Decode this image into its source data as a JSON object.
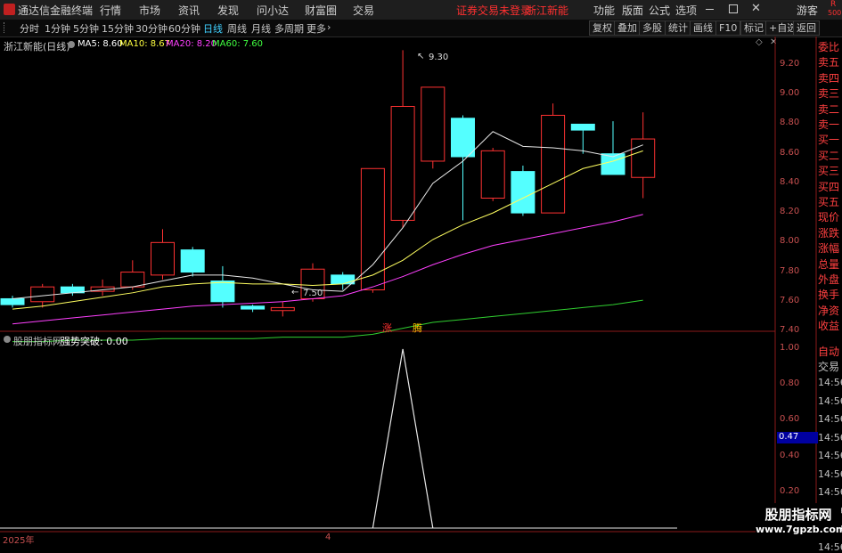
{
  "app": {
    "title": "通达信金融终端",
    "menus": [
      "行情",
      "市场",
      "资讯",
      "发现",
      "问小达",
      "财富圈",
      "交易"
    ],
    "status_left": "证券交易未登录",
    "status_right": "浙江新能",
    "right_menus": [
      "功能",
      "版面",
      "公式",
      "选项"
    ],
    "guest": "游客",
    "corner": "R",
    "corner_num": "500"
  },
  "toolbar": {
    "periods": [
      "分时",
      "1分钟",
      "5分钟",
      "15分钟",
      "30分钟",
      "60分钟",
      "日线",
      "周线",
      "月线",
      "多周期",
      "更多"
    ],
    "active_period": "日线",
    "buttons": [
      "复权",
      "叠加",
      "多股",
      "统计",
      "画线",
      "F10",
      "标记",
      "+自选",
      "返回"
    ]
  },
  "chart_header": {
    "stock": "浙江新能(日线)",
    "ma": [
      {
        "label": "MA5: 8.60",
        "color": "#ffffff"
      },
      {
        "label": "MA10: 8.67",
        "color": "#ffff40"
      },
      {
        "label": "MA20: 8.20",
        "color": "#ff40ff"
      },
      {
        "label": "MA60: 7.60",
        "color": "#40ff40"
      }
    ]
  },
  "indicator_header": {
    "name": "股朋指标网",
    "formula": "强势突破: 0.00"
  },
  "price_axis": [
    "9.20",
    "9.00",
    "8.80",
    "8.60",
    "8.40",
    "8.20",
    "8.00",
    "7.80",
    "7.60",
    "7.40"
  ],
  "ind_axis": [
    "1.00",
    "0.80",
    "0.60",
    "0.40",
    "0.20"
  ],
  "ind_current": "0.47",
  "annotations": {
    "high": "9.30",
    "low": "7.50",
    "rise": "涨",
    "surge": "腾"
  },
  "time_axis": {
    "year": "2025年",
    "month": "4"
  },
  "side_panel": {
    "quote_labels": [
      "委比",
      "卖五",
      "卖四",
      "卖三",
      "卖二",
      "卖一",
      "买一",
      "买二",
      "买三",
      "买四",
      "买五",
      "现价",
      "涨跌",
      "涨幅",
      "总量",
      "外盘",
      "换手",
      "净资",
      "收益"
    ],
    "trade_labels": [
      "自动",
      "交易"
    ],
    "times": [
      "14:56",
      "14:56",
      "14:56",
      "14:56",
      "14:56",
      "14:56",
      "14:56",
      "14:56",
      "14:56",
      "14:56"
    ]
  },
  "watermark": {
    "name": "股朋指标网",
    "url": "www.7gpzb.com"
  },
  "chart_data": {
    "type": "candlestick",
    "ylim": [
      7.3,
      9.35
    ],
    "candles": [
      {
        "o": 7.62,
        "c": 7.58,
        "h": 7.64,
        "l": 7.56
      },
      {
        "o": 7.6,
        "c": 7.7,
        "h": 7.72,
        "l": 7.56
      },
      {
        "o": 7.7,
        "c": 7.66,
        "h": 7.72,
        "l": 7.64
      },
      {
        "o": 7.67,
        "c": 7.7,
        "h": 7.75,
        "l": 7.64
      },
      {
        "o": 7.7,
        "c": 7.8,
        "h": 7.88,
        "l": 7.68
      },
      {
        "o": 7.78,
        "c": 8.0,
        "h": 8.09,
        "l": 7.75
      },
      {
        "o": 7.95,
        "c": 7.8,
        "h": 7.97,
        "l": 7.77
      },
      {
        "o": 7.74,
        "c": 7.6,
        "h": 7.84,
        "l": 7.56
      },
      {
        "o": 7.57,
        "c": 7.55,
        "h": 7.58,
        "l": 7.53
      },
      {
        "o": 7.54,
        "c": 7.56,
        "h": 7.6,
        "l": 7.5
      },
      {
        "o": 7.62,
        "c": 7.82,
        "h": 7.86,
        "l": 7.6
      },
      {
        "o": 7.78,
        "c": 7.72,
        "h": 7.8,
        "l": 7.68
      },
      {
        "o": 7.68,
        "c": 8.5,
        "h": 8.5,
        "l": 7.66
      },
      {
        "o": 8.15,
        "c": 8.92,
        "h": 9.3,
        "l": 8.1
      },
      {
        "o": 8.55,
        "c": 9.05,
        "h": 9.05,
        "l": 8.5
      },
      {
        "o": 8.84,
        "c": 8.58,
        "h": 8.86,
        "l": 8.15
      },
      {
        "o": 8.3,
        "c": 8.62,
        "h": 8.64,
        "l": 8.28
      },
      {
        "o": 8.48,
        "c": 8.2,
        "h": 8.52,
        "l": 8.18
      },
      {
        "o": 8.2,
        "c": 8.86,
        "h": 8.94,
        "l": 8.2
      },
      {
        "o": 8.8,
        "c": 8.76,
        "h": 8.8,
        "l": 8.6
      },
      {
        "o": 8.6,
        "c": 8.46,
        "h": 8.82,
        "l": 8.46
      },
      {
        "o": 8.44,
        "c": 8.7,
        "h": 8.88,
        "l": 8.3
      }
    ],
    "ma5": [
      7.62,
      7.64,
      7.66,
      7.68,
      7.7,
      7.74,
      7.78,
      7.78,
      7.76,
      7.72,
      7.68,
      7.67,
      7.85,
      8.1,
      8.4,
      8.55,
      8.75,
      8.65,
      8.64,
      8.62,
      8.58,
      8.66
    ],
    "ma10": [
      7.55,
      7.57,
      7.6,
      7.63,
      7.66,
      7.7,
      7.72,
      7.73,
      7.72,
      7.72,
      7.71,
      7.72,
      7.78,
      7.88,
      8.02,
      8.12,
      8.2,
      8.3,
      8.4,
      8.5,
      8.55,
      8.62
    ],
    "ma20": [
      7.45,
      7.47,
      7.49,
      7.51,
      7.53,
      7.55,
      7.57,
      7.58,
      7.59,
      7.6,
      7.62,
      7.64,
      7.7,
      7.77,
      7.85,
      7.92,
      7.98,
      8.02,
      8.06,
      8.1,
      8.14,
      8.19
    ],
    "ma60": [
      7.33,
      7.33,
      7.34,
      7.34,
      7.34,
      7.35,
      7.35,
      7.35,
      7.35,
      7.36,
      7.36,
      7.36,
      7.38,
      7.42,
      7.46,
      7.48,
      7.5,
      7.52,
      7.54,
      7.56,
      7.58,
      7.61
    ],
    "indicator": {
      "ylim": [
        0,
        1.05
      ],
      "values": [
        0,
        0,
        0,
        0,
        0,
        0,
        0,
        0,
        0,
        0,
        0,
        0,
        0,
        1,
        0,
        0,
        0,
        0,
        0,
        0,
        0,
        0
      ]
    }
  }
}
